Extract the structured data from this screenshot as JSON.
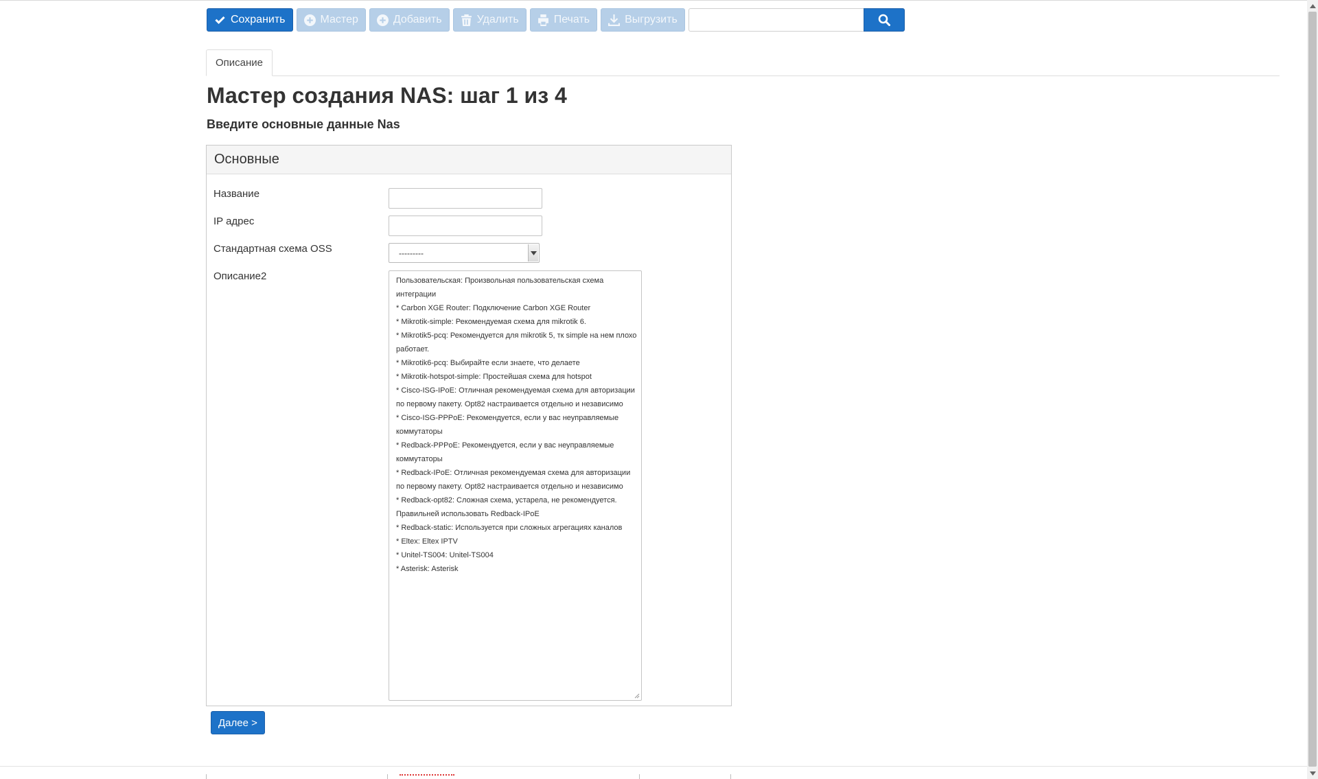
{
  "toolbar": {
    "save_label": "Сохранить",
    "wizard_label": "Мастер",
    "add_label": "Добавить",
    "delete_label": "Удалить",
    "print_label": "Печать",
    "export_label": "Выгрузить",
    "search_value": ""
  },
  "tabs": [
    {
      "label": "Описание"
    }
  ],
  "page": {
    "title": "Мастер создания NAS: шаг 1 из 4",
    "subtitle": "Введите основные данные Nas"
  },
  "panel": {
    "heading": "Основные",
    "fields": {
      "name_label": "Название",
      "name_value": "",
      "ip_label": "IP адрес",
      "ip_value": "",
      "oss_label": "Стандартная схема OSS",
      "oss_selected": "---------",
      "desc_label": "Описание2",
      "desc_lines": [
        "Пользовательская: Произвольная пользовательская схема",
        "интеграции",
        "* Carbon XGE Router: Подключение Carbon XGE Router",
        "* Mikrotik-simple: Рекомендуемая схема для mikrotik 6.",
        "* Mikrotik5-pcq: Рекомендуется для mikrotik 5, тк simple на нем плохо",
        "работает.",
        "* Mikrotik6-pcq: Выбирайте если знаете, что делаете",
        "* Mikrotik-hotspot-simple: Простейшая схема для hotspot",
        "* Cisco-ISG-IPoE: Отличная рекомендуемая схема для авторизации",
        "по первому пакету. Opt82 настраивается отдельно и независимо",
        "* Cisco-ISG-PPPoE: Рекомендуется, если у вас неуправляемые",
        "коммутаторы",
        "* Redback-PPPoE: Рекомендуется, если у вас неуправляемые",
        "коммутаторы",
        "* Redback-IPoE: Отличная рекомендуемая схема для авторизации",
        "по первому пакету. Opt82 настраивается отдельно и независимо",
        "* Redback-opt82: Сложная схема, устарела, не рекомендуется.",
        "Правильней использовать Redback-IPoE",
        "* Redback-static: Используется при сложных агрегациях каналов",
        "* Eltex: Eltex IPTV",
        "* Unitel-TS004: Unitel-TS004",
        "* Asterisk: Asterisk"
      ]
    }
  },
  "next_button": "Далее >",
  "colors": {
    "primary": "#1d72c8",
    "disabled": "#b6cfe8",
    "panel_heading_bg": "#f5f5f5"
  }
}
